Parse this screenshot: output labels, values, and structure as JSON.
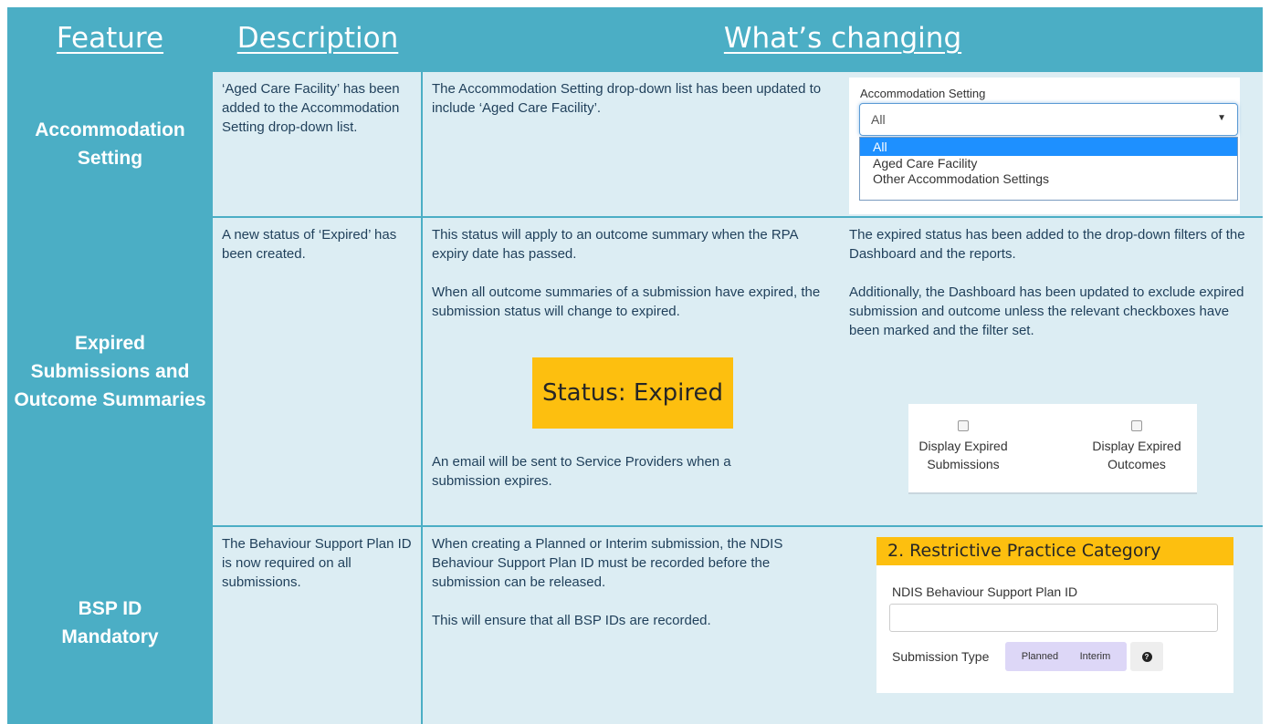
{
  "headers": {
    "feature": "Feature",
    "description": "Description",
    "changing": "What’s changing"
  },
  "rows": [
    {
      "feature": "Accommodation Setting",
      "description": "‘Aged Care Facility’ has been added to the Accommodation Setting drop-down list.",
      "changing": "The Accommodation Setting drop-down list has been updated to include ‘Aged Care Facility’.",
      "widget": {
        "label": "Accommodation Setting",
        "selected": "All",
        "options": [
          "All",
          "Aged Care Facility",
          "Other Accommodation Settings"
        ]
      }
    },
    {
      "feature": "Expired Submissions and Outcome Summaries",
      "description": "A new status of ‘Expired’ has been created.",
      "changing_p1": "This status will apply to an outcome summary when the RPA expiry date has passed.",
      "changing_p2": "When all outcome summaries of a submission have expired, the submission status will change to expired.",
      "status_label": "Status: Expired",
      "changing_p3": "An email will be sent to Service Providers when a submission expires.",
      "extra_p1": "The expired status has been added to the drop-down filters of the Dashboard and the reports.",
      "extra_p2": "Additionally, the Dashboard has been updated to exclude expired submission and outcome unless the relevant checkboxes have been marked and the filter set.",
      "checkbox_1_line1": "Display Expired",
      "checkbox_1_line2": "Submissions",
      "checkbox_2_line1": "Display Expired",
      "checkbox_2_line2": "Outcomes"
    },
    {
      "feature": "BSP ID Mandatory",
      "description": "The Behaviour Support Plan ID is now required on all submissions.",
      "changing_p1": "When creating a Planned or Interim submission, the NDIS Behaviour Support Plan ID must be recorded before the submission can be released.",
      "changing_p2": "This will ensure that all BSP IDs are recorded.",
      "widget": {
        "heading": "2. Restrictive Practice Category",
        "field_label": "NDIS Behaviour Support Plan ID",
        "type_label": "Submission Type",
        "type_options": [
          "Planned",
          "Interim"
        ]
      }
    }
  ],
  "colors": {
    "frame": "#4baec5",
    "cell": "#dcedf3",
    "accent_yellow": "#fdbf0f",
    "text": "#1f3f5a"
  }
}
